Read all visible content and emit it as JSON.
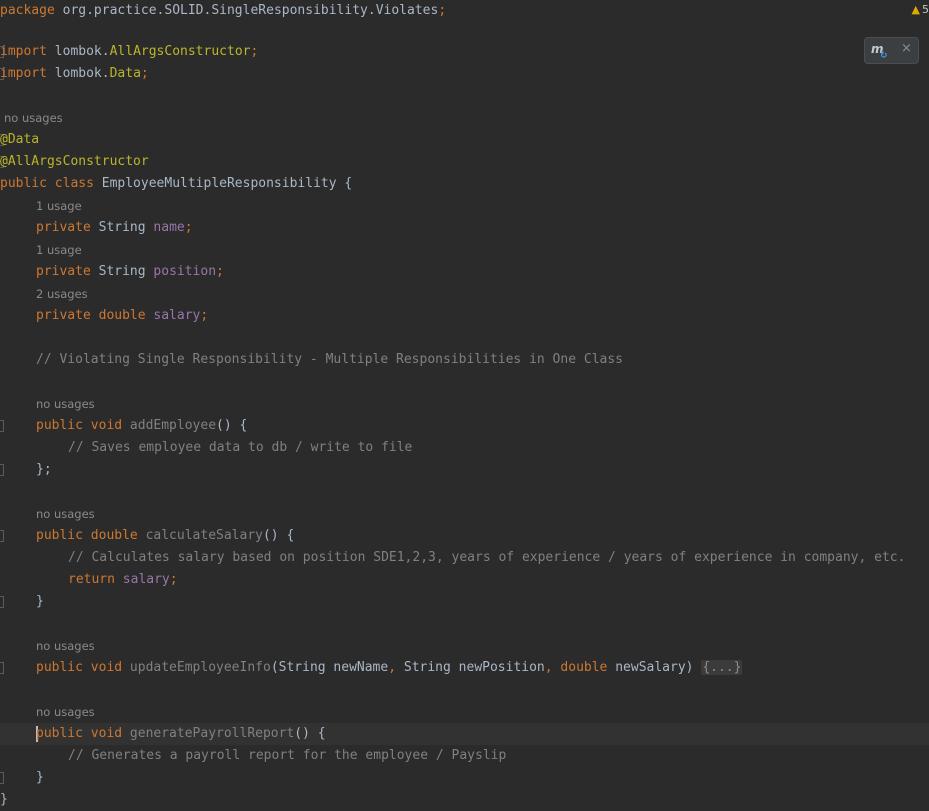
{
  "editor": {
    "pkg": {
      "kw": "package",
      "name": " org.practice.SOLID.SingleResponsibility.Violates",
      "semi": ";"
    },
    "imports": [
      {
        "kw": "import",
        "pre": " lombok.",
        "cls": "AllArgsConstructor",
        "semi": ";"
      },
      {
        "kw": "import",
        "pre": " lombok.",
        "cls": "Data",
        "semi": ";"
      }
    ],
    "class_hint": "no usages",
    "annotations": [
      "@Data",
      "@AllArgsConstructor"
    ],
    "class_decl": {
      "kw": "public class",
      "name": " EmployeeMultipleResponsibility {"
    },
    "fields": [
      {
        "hint": "1 usage",
        "kw": "private",
        "type": " String ",
        "name": "name",
        "semi": ";"
      },
      {
        "hint": "1 usage",
        "kw": "private",
        "type": " String ",
        "name": "position",
        "semi": ";"
      },
      {
        "hint": "2 usages",
        "kw": "private double",
        "type": " ",
        "name": "salary",
        "semi": ";"
      }
    ],
    "section_comment": "// Violating Single Responsibility - Multiple Responsibilities in One Class",
    "add_employee": {
      "hint": "no usages",
      "kw": "public void",
      "name": "addEmployee",
      "tail": "() {",
      "body_comment": "// Saves employee data to db / write to file",
      "close": "};"
    },
    "calculate_salary": {
      "hint": "no usages",
      "kw": "public double",
      "name": "calculateSalary",
      "tail": "() {",
      "body_comment": "// Calculates salary based on position SDE1,2,3, years of experience / years of experience in company, etc.",
      "return_kw": "return",
      "return_val": "salary",
      "return_semi": ";",
      "close": "}"
    },
    "update_info": {
      "hint": "no usages",
      "kw": "public void",
      "name": "updateEmployeeInfo",
      "p1": "(String newName",
      "c1": ",",
      "p2": " String newPosition",
      "c2": ",",
      "p3kw": " double",
      "p3": " newSalary) ",
      "folded": "{...}"
    },
    "generate_report": {
      "hint": "no usages",
      "kw": "public void",
      "name": "generatePayrollReport",
      "tail": "() {",
      "body_comment": "// Generates a payroll report for the employee / Payslip",
      "close": "}"
    },
    "class_close": "}"
  },
  "inspection": {
    "warning_count": "5"
  },
  "maven_popup": {
    "icon": "maven-reload-icon",
    "logo": "m",
    "close": "×"
  },
  "colors": {
    "background": "#2b2b2b",
    "keyword": "#cc7832",
    "annotation": "#bbb529",
    "field": "#9876aa",
    "comment": "#808080",
    "text": "#a9b7c6"
  }
}
